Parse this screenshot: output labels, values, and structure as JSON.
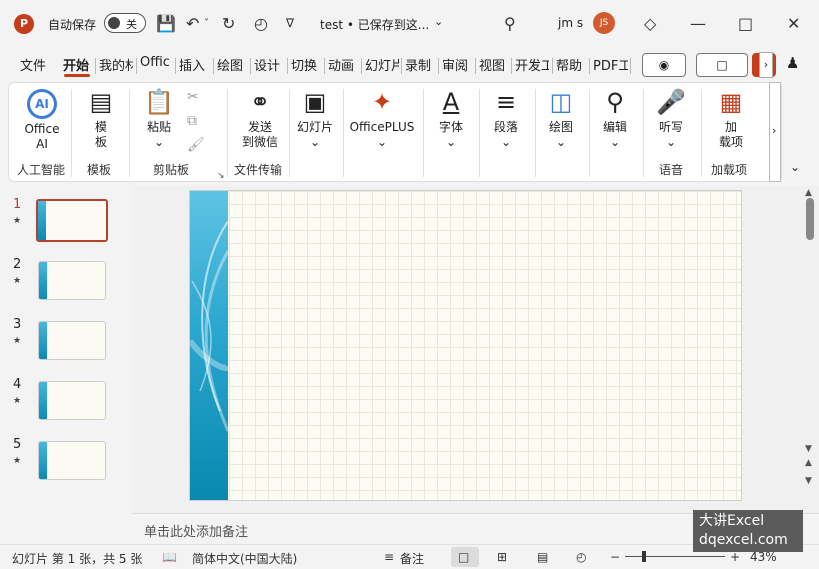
{
  "titlebar": {
    "app_logo": "P",
    "autosave_label": "自动保存",
    "autosave_state": "关",
    "doc_title": "test • 已保存到这...",
    "user_name": "jm s",
    "avatar_initials": "JS",
    "icons": [
      "save-icon",
      "undo-icon",
      "redo-icon",
      "present-icon",
      "search-icon",
      "diamond-icon",
      "minimize-icon",
      "maximize-icon",
      "close-icon"
    ]
  },
  "tabs": [
    "文件",
    "开始",
    "我的材",
    "Offic",
    "插入",
    "绘图",
    "设计",
    "切换",
    "动画",
    "幻灯片",
    "录制",
    "审阅",
    "视图",
    "开发工",
    "帮助",
    "PDF工"
  ],
  "active_tab": "开始",
  "ribbon": {
    "office_ai": "Office AI",
    "office_ai_line1": "Office",
    "office_ai_line2": "AI",
    "template_line1": "模",
    "template_line2": "板",
    "paste": "粘贴",
    "send_wechat_line1": "发送",
    "send_wechat_line2": "到微信",
    "slides": "幻灯片",
    "officeplus": "OfficePLUS",
    "font": "字体",
    "paragraph": "段落",
    "drawing": "绘图",
    "editing": "编辑",
    "dictate": "听写",
    "addins_line1": "加",
    "addins_line2": "载项",
    "groups": {
      "ai": "人工智能",
      "template": "模板",
      "clipboard": "剪贴板",
      "file_transfer": "文件传输",
      "voice": "语音",
      "addins": "加载项"
    }
  },
  "thumbnails": [
    {
      "num": "1",
      "star": "★"
    },
    {
      "num": "2",
      "star": "★"
    },
    {
      "num": "3",
      "star": "★"
    },
    {
      "num": "4",
      "star": "★"
    },
    {
      "num": "5",
      "star": "★"
    }
  ],
  "selected_slide": 1,
  "notes_placeholder": "单击此处添加备注",
  "status": {
    "slide_info": "幻灯片 第 1 张，共 5 张",
    "language": "简体中文(中国大陆)",
    "notes_button": "备注",
    "zoom_minus": "−",
    "zoom_plus": "+",
    "zoom": "43%"
  },
  "watermark": {
    "line1": "大讲Excel",
    "line2": "dqexcel.com"
  },
  "colors": {
    "accent": "#c43e1c",
    "slide_bar": "#2aa6cf",
    "selected_border": "#b5432a"
  }
}
